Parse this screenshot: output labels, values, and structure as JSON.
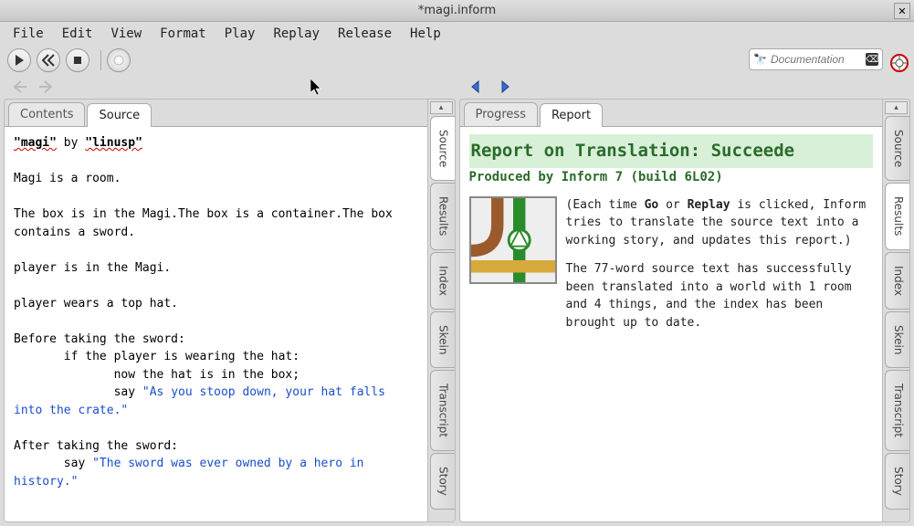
{
  "window": {
    "title": "*magi.inform"
  },
  "menu": {
    "items": [
      "File",
      "Edit",
      "View",
      "Format",
      "Play",
      "Replay",
      "Release",
      "Help"
    ]
  },
  "toolbar": {
    "search_placeholder": "Documentation"
  },
  "left_pane": {
    "tabs": [
      {
        "label": "Contents",
        "active": false
      },
      {
        "label": "Source",
        "active": true
      }
    ],
    "side_tabs": [
      {
        "label": "Source",
        "active": true
      },
      {
        "label": "Results",
        "active": false
      },
      {
        "label": "Index",
        "active": false
      },
      {
        "label": "Skein",
        "active": false
      },
      {
        "label": "Transcript",
        "active": false
      },
      {
        "label": "Story",
        "active": false
      }
    ],
    "source": {
      "title_open": "\"magi\"",
      "by": " by ",
      "author": "\"linusp\"",
      "body1": "Magi is a room.",
      "body2": "The box is in the Magi.The box is a container.The box contains a sword.",
      "body3": "player is in the Magi.",
      "body4": "player wears a top hat.",
      "body5": "Before taking the sword:",
      "body6": "       if the player is wearing the hat:",
      "body7": "              now the hat is in the box;",
      "body8a": "              say ",
      "str1": "\"As you stoop down, your hat falls into the crate.\"",
      "body9": "After taking the sword:",
      "body10a": "       say ",
      "str2": "\"The sword was ever owned by a hero in history.\""
    }
  },
  "right_pane": {
    "tabs": [
      {
        "label": "Progress",
        "active": false
      },
      {
        "label": "Report",
        "active": true
      }
    ],
    "side_tabs": [
      {
        "label": "Source",
        "active": false
      },
      {
        "label": "Results",
        "active": true
      },
      {
        "label": "Index",
        "active": false
      },
      {
        "label": "Skein",
        "active": false
      },
      {
        "label": "Transcript",
        "active": false
      },
      {
        "label": "Story",
        "active": false
      }
    ],
    "report": {
      "title": "Report on Translation: Succeede",
      "subtitle": "Produced by Inform 7 (build 6L02)",
      "p1_a": "(Each time ",
      "p1_go": "Go",
      "p1_b": " or ",
      "p1_replay": "Replay",
      "p1_c": " is clicked, Inform tries to translate the source text into a working story, and updates this report.)",
      "p2": "The 77-word source text has successfully been translated into a world with 1 room and 4 things, and the index has been brought up to date."
    }
  }
}
